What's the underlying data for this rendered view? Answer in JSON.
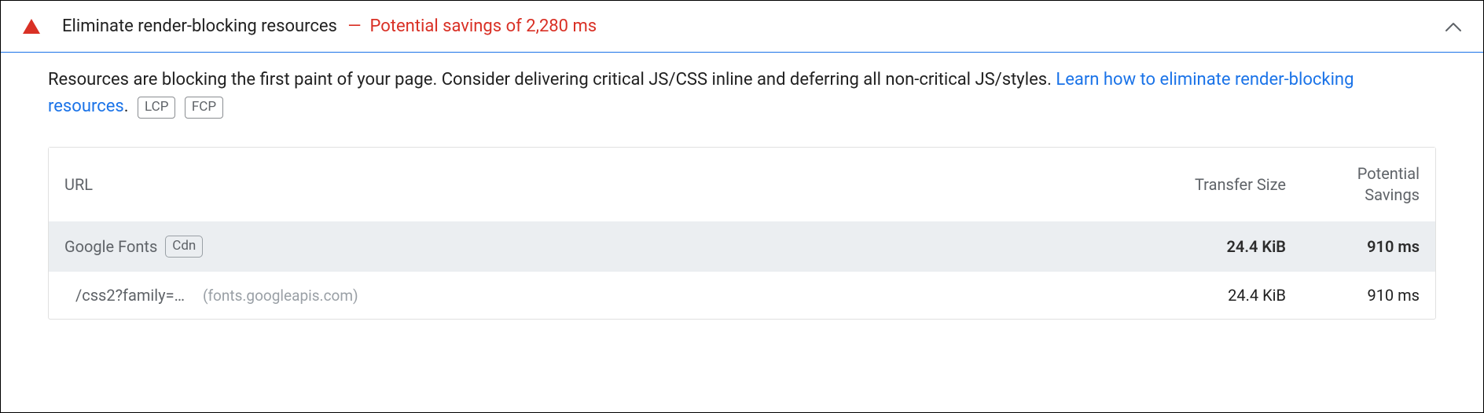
{
  "audit": {
    "title": "Eliminate render-blocking resources",
    "separator": "—",
    "savings_label": "Potential savings of 2,280 ms",
    "description_pre": "Resources are blocking the first paint of your page. Consider delivering critical JS/CSS inline and deferring all non-critical JS/styles. ",
    "learn_link": "Learn how to eliminate render-blocking resources",
    "description_post": ".",
    "badges": [
      "LCP",
      "FCP"
    ]
  },
  "table": {
    "headers": {
      "url": "URL",
      "transfer": "Transfer Size",
      "savings": "Potential Savings"
    },
    "groups": [
      {
        "label": "Google Fonts",
        "tag": "Cdn",
        "transfer": "24.4 KiB",
        "savings": "910 ms",
        "items": [
          {
            "path": "/css2?family=…",
            "domain": "(fonts.googleapis.com)",
            "transfer": "24.4 KiB",
            "savings": "910 ms"
          }
        ]
      }
    ]
  }
}
